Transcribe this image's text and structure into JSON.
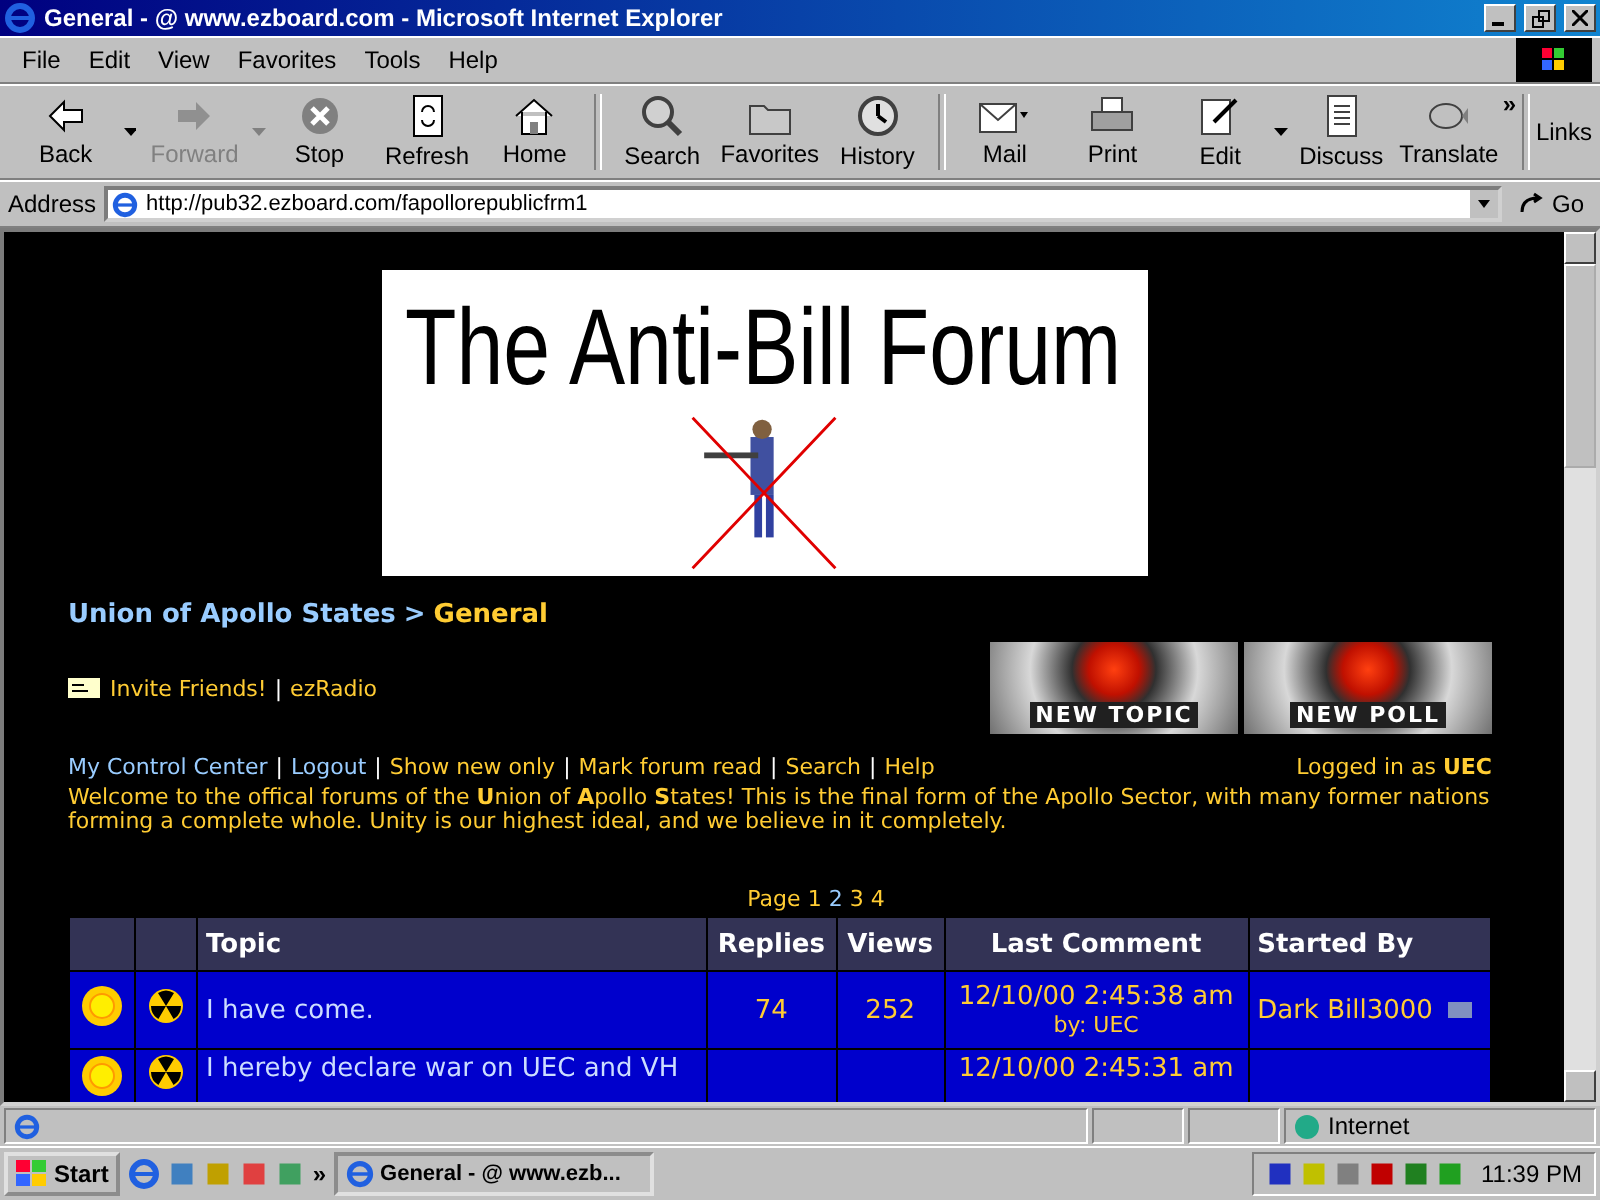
{
  "window": {
    "title": "General - @ www.ezboard.com - Microsoft Internet Explorer"
  },
  "menu": [
    "File",
    "Edit",
    "View",
    "Favorites",
    "Tools",
    "Help"
  ],
  "toolbar": [
    {
      "label": "Back",
      "disabled": false,
      "dropdown": true,
      "kind": "back"
    },
    {
      "label": "Forward",
      "disabled": true,
      "dropdown": true,
      "kind": "forward"
    },
    {
      "label": "Stop",
      "disabled": false,
      "dropdown": false,
      "kind": "stop"
    },
    {
      "label": "Refresh",
      "disabled": false,
      "dropdown": false,
      "kind": "refresh"
    },
    {
      "label": "Home",
      "disabled": false,
      "dropdown": false,
      "kind": "home"
    },
    {
      "label": "Search",
      "disabled": false,
      "dropdown": false,
      "kind": "search",
      "sep": true
    },
    {
      "label": "Favorites",
      "disabled": false,
      "dropdown": false,
      "kind": "favorites"
    },
    {
      "label": "History",
      "disabled": false,
      "dropdown": false,
      "kind": "history"
    },
    {
      "label": "Mail",
      "disabled": false,
      "dropdown": false,
      "kind": "mail",
      "sep": true
    },
    {
      "label": "Print",
      "disabled": false,
      "dropdown": false,
      "kind": "print"
    },
    {
      "label": "Edit",
      "disabled": false,
      "dropdown": true,
      "kind": "edit"
    },
    {
      "label": "Discuss",
      "disabled": false,
      "dropdown": false,
      "kind": "discuss"
    },
    {
      "label": "Translate",
      "disabled": false,
      "dropdown": false,
      "kind": "translate"
    }
  ],
  "links_label": "Links",
  "chevron": "»",
  "address": {
    "label": "Address",
    "url": "http://pub32.ezboard.com/fapollorepublicfrm1",
    "go": "Go"
  },
  "banner": {
    "title": "The Anti-Bill Forum"
  },
  "breadcrumb": {
    "parent": "Union of Apollo States",
    "separator": ">",
    "current": "General"
  },
  "invite": [
    "Invite Friends!",
    "ezRadio"
  ],
  "link_separator": "|",
  "post_buttons": [
    "NEW TOPIC",
    "NEW POLL"
  ],
  "nav_links": [
    "My Control Center",
    "Logout",
    "Show new only",
    "Mark forum read",
    "Search",
    "Help"
  ],
  "logged_in": {
    "prefix": "Logged in as",
    "user": "UEC"
  },
  "welcome": "Welcome to the offical forums of the **U**nion of **A**pollo **S**tates! This is the final form of the Apollo Sector, with many former nations forming a complete whole. Unity is our highest ideal, and we believe in it completely.",
  "pagination": {
    "label": "Page",
    "pages": [
      {
        "label": "1",
        "selected": false
      },
      {
        "label": "2",
        "selected": true
      },
      {
        "label": "3",
        "selected": false
      },
      {
        "label": "4",
        "selected": false
      }
    ]
  },
  "table": {
    "columns": [
      "Topic",
      "Replies",
      "Views",
      "Last Comment",
      "Started By"
    ],
    "rows": [
      {
        "topic": "I have come.",
        "replies": "74",
        "views": "252",
        "last_comment": "12/10/00 2:45:38 am",
        "by": "by: UEC",
        "started_by": "Dark Bill3000"
      },
      {
        "topic": "I hereby declare war on UEC and VH",
        "last_comment": "12/10/00 2:45:31 am"
      }
    ]
  },
  "status_bar": {
    "zone": "Internet"
  },
  "taskbar": {
    "start": "Start",
    "task": "General - @ www.ezb...",
    "chevron": "»",
    "clock": "11:39 PM"
  }
}
